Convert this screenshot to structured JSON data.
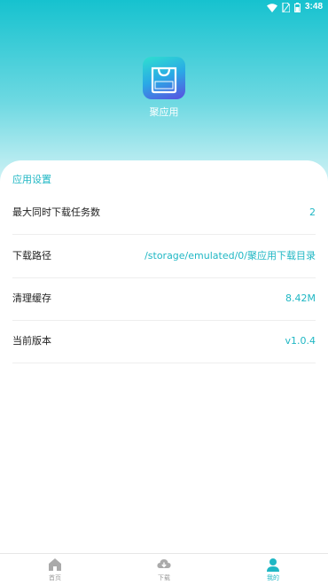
{
  "status_bar": {
    "time": "3:48",
    "icons": [
      "wifi-icon",
      "sim-icon",
      "battery-icon"
    ]
  },
  "app": {
    "icon_text": "聚应用",
    "name": "聚应用"
  },
  "settings": {
    "section_title": "应用设置",
    "rows": [
      {
        "label": "最大同时下载任务数",
        "value": "2"
      },
      {
        "label": "下载路径",
        "value": "/storage/emulated/0/聚应用下载目录"
      },
      {
        "label": "清理缓存",
        "value": "8.42M"
      },
      {
        "label": "当前版本",
        "value": "v1.0.4"
      }
    ]
  },
  "bottom_nav": {
    "items": [
      {
        "label": "首页",
        "icon": "home-icon",
        "active": false
      },
      {
        "label": "下载",
        "icon": "cloud-download-icon",
        "active": false
      },
      {
        "label": "我的",
        "icon": "user-icon",
        "active": true
      }
    ]
  },
  "colors": {
    "accent": "#1fb7c4",
    "header_gradient_top": "#16c2cf",
    "inactive": "#999999"
  }
}
